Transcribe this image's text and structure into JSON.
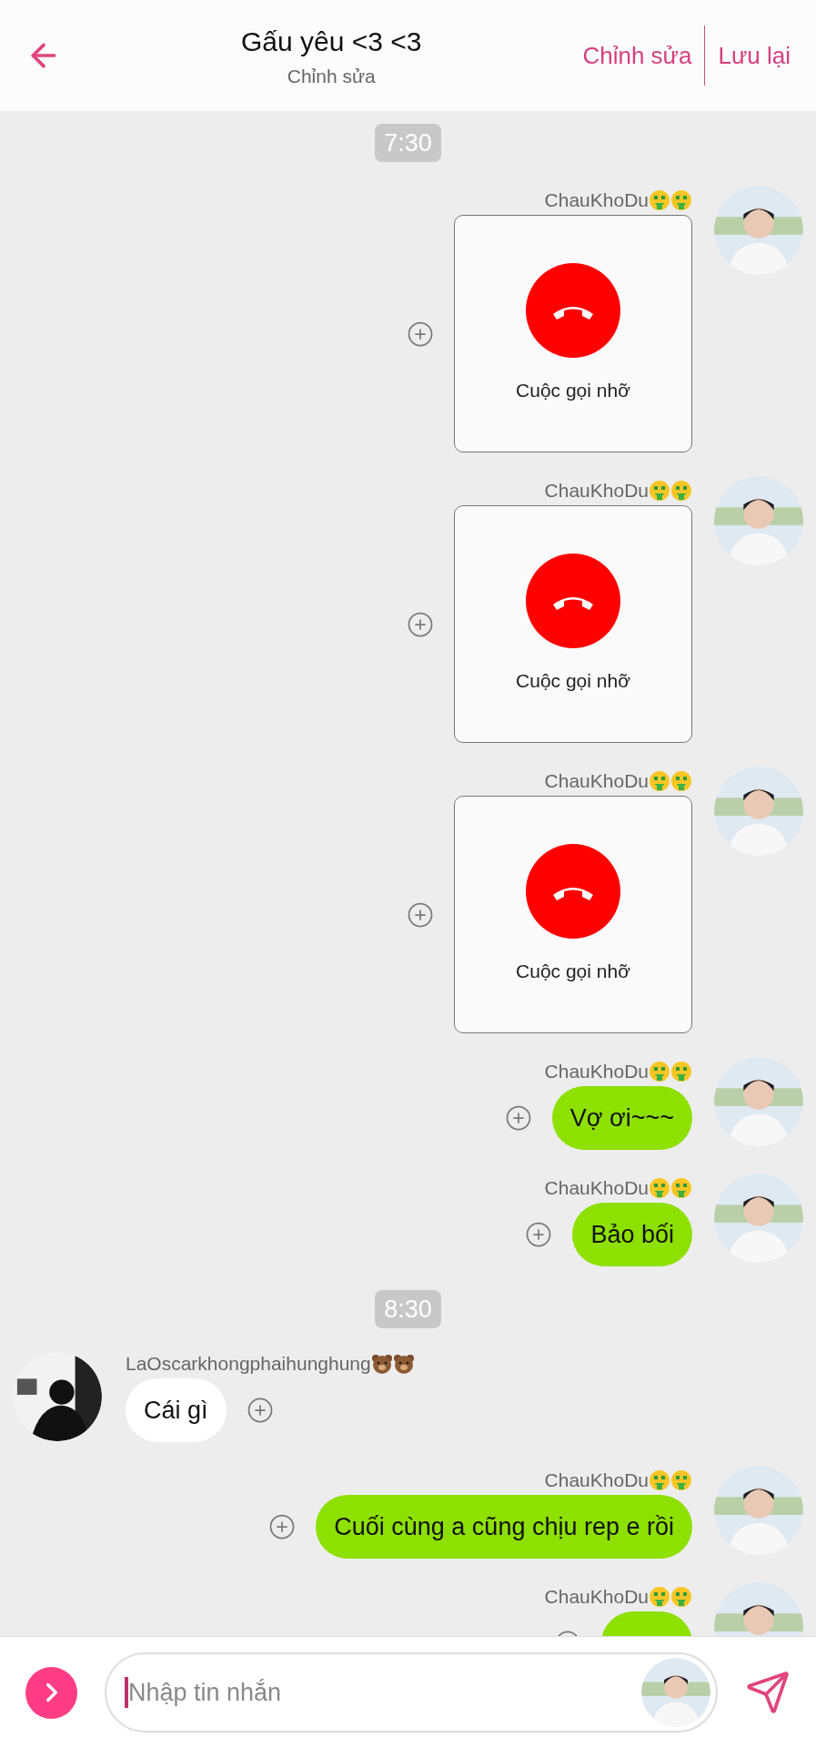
{
  "header": {
    "title": "Gấu yêu <3 <3",
    "subtitle": "Chỉnh sửa",
    "actions": [
      "Chỉnh sửa",
      "Lưu lại"
    ]
  },
  "messages": [
    {
      "kind": "time",
      "text": "7:30"
    },
    {
      "kind": "call",
      "incoming": false,
      "sender": "ChauKhoDu",
      "text": "Cuộc gọi nhỡ"
    },
    {
      "kind": "call",
      "incoming": false,
      "sender": "ChauKhoDu",
      "text": "Cuộc gọi nhỡ"
    },
    {
      "kind": "call",
      "incoming": false,
      "sender": "ChauKhoDu",
      "text": "Cuộc gọi nhỡ"
    },
    {
      "kind": "text",
      "incoming": false,
      "sender": "ChauKhoDu",
      "text": "Vợ ơi~~~"
    },
    {
      "kind": "text",
      "incoming": false,
      "sender": "ChauKhoDu",
      "text": "Bảo bối"
    },
    {
      "kind": "time",
      "text": "8:30"
    },
    {
      "kind": "text",
      "incoming": true,
      "sender": "LaOscarkhongphaihunghung",
      "text": "Cái gì"
    },
    {
      "kind": "text",
      "incoming": false,
      "sender": "ChauKhoDu",
      "text": "Cuối cùng a cũng chịu rep e rồi"
    },
    {
      "kind": "text",
      "incoming": false,
      "sender": "ChauKhoDu"
    }
  ],
  "composer": {
    "placeholder": "Nhập tin nhắn"
  }
}
